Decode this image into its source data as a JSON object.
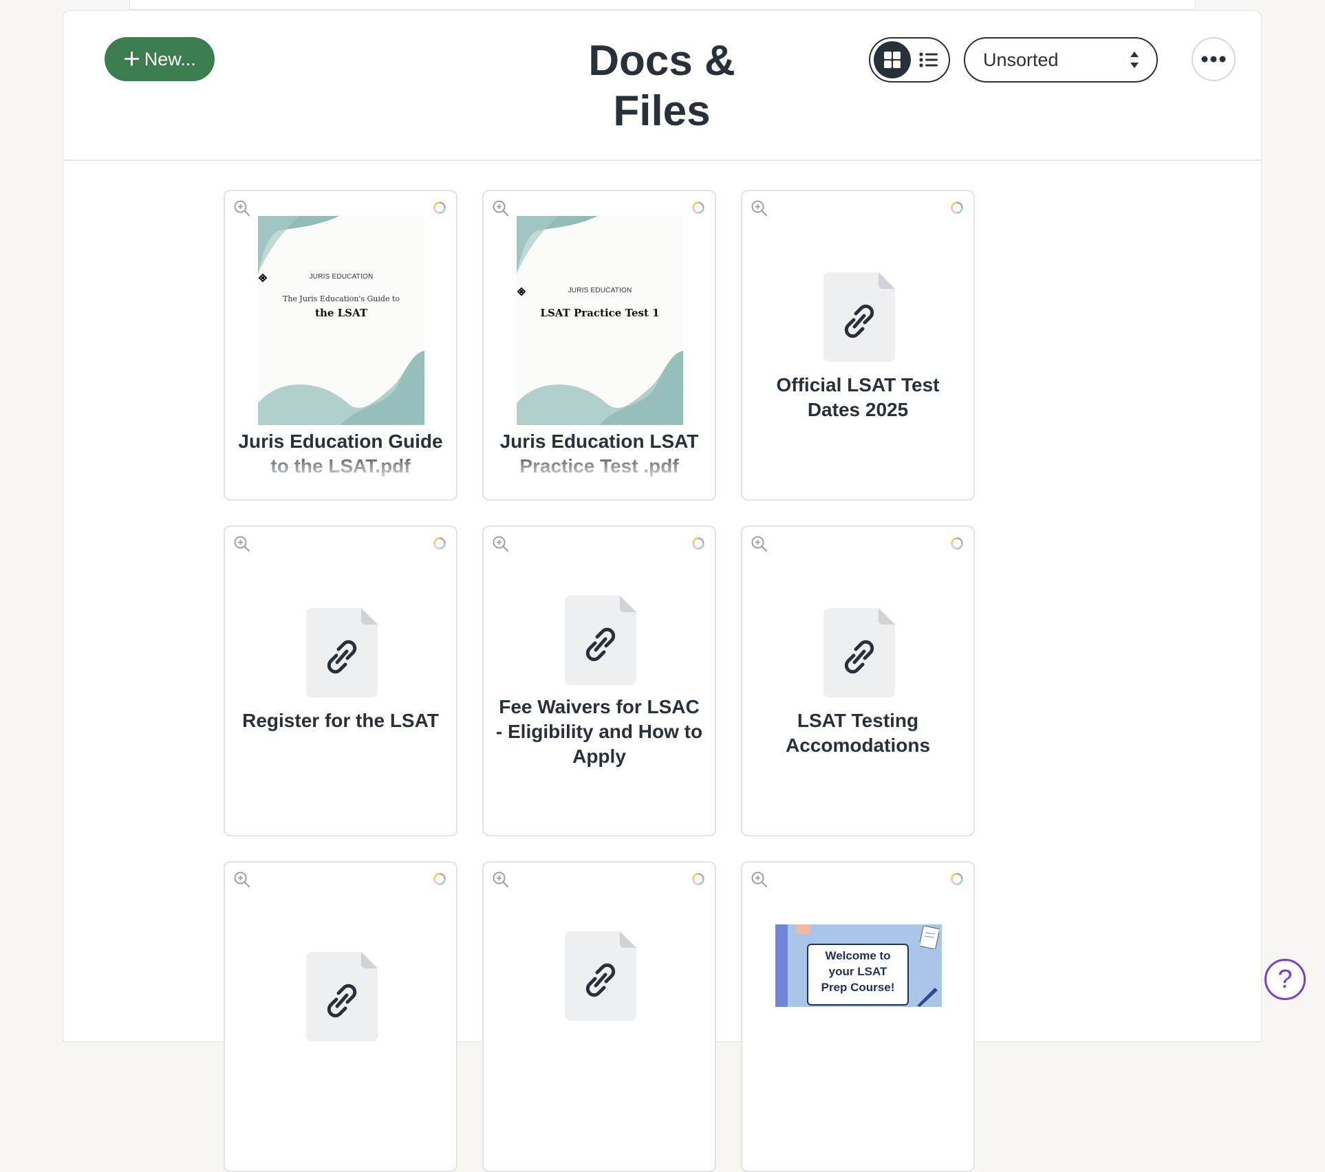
{
  "header": {
    "title_line1": "Docs &",
    "title_line2": "Files",
    "new_button_label": "New...",
    "sort_value": "Unsorted",
    "view_mode": "grid"
  },
  "colors": {
    "primary_green": "#3c7d4f",
    "text_dark": "#283139",
    "help_purple": "#7a3fc8",
    "thumb_teal": "#7fb0aa"
  },
  "cards": [
    {
      "type": "pdf-thumbnail",
      "title": "Juris Education Guide to the LSAT.pdf",
      "thumb_brand": "JURIS EDUCATION",
      "thumb_subtitle": "The Juris Education's Guide to",
      "thumb_heading": "the LSAT"
    },
    {
      "type": "pdf-thumbnail",
      "title": "Juris Education LSAT Practice Test .pdf",
      "thumb_brand": "JURIS EDUCATION",
      "thumb_subtitle": "",
      "thumb_heading": "LSAT Practice Test 1"
    },
    {
      "type": "link",
      "title": "Official LSAT Test Dates 2025"
    },
    {
      "type": "link",
      "title": "Register for the LSAT"
    },
    {
      "type": "link",
      "title": "Fee Waivers for LSAC - Eligibility and How to Apply"
    },
    {
      "type": "link",
      "title": "LSAT Testing Accomodations"
    },
    {
      "type": "link",
      "title": ""
    },
    {
      "type": "link",
      "title": ""
    },
    {
      "type": "image",
      "title": "",
      "welcome_line1": "Welcome to",
      "welcome_line2": "your LSAT",
      "welcome_line3": "Prep Course!"
    }
  ],
  "icons": {
    "new": "plus-icon",
    "grid_view": "grid-view-icon",
    "list_view": "list-view-icon",
    "sort": "sort-arrows-icon",
    "more": "more-horizontal-icon",
    "zoom": "zoom-in-icon",
    "status": "sync-ring-icon",
    "link_file": "link-file-icon",
    "help": "help-icon"
  },
  "help_label": "?"
}
